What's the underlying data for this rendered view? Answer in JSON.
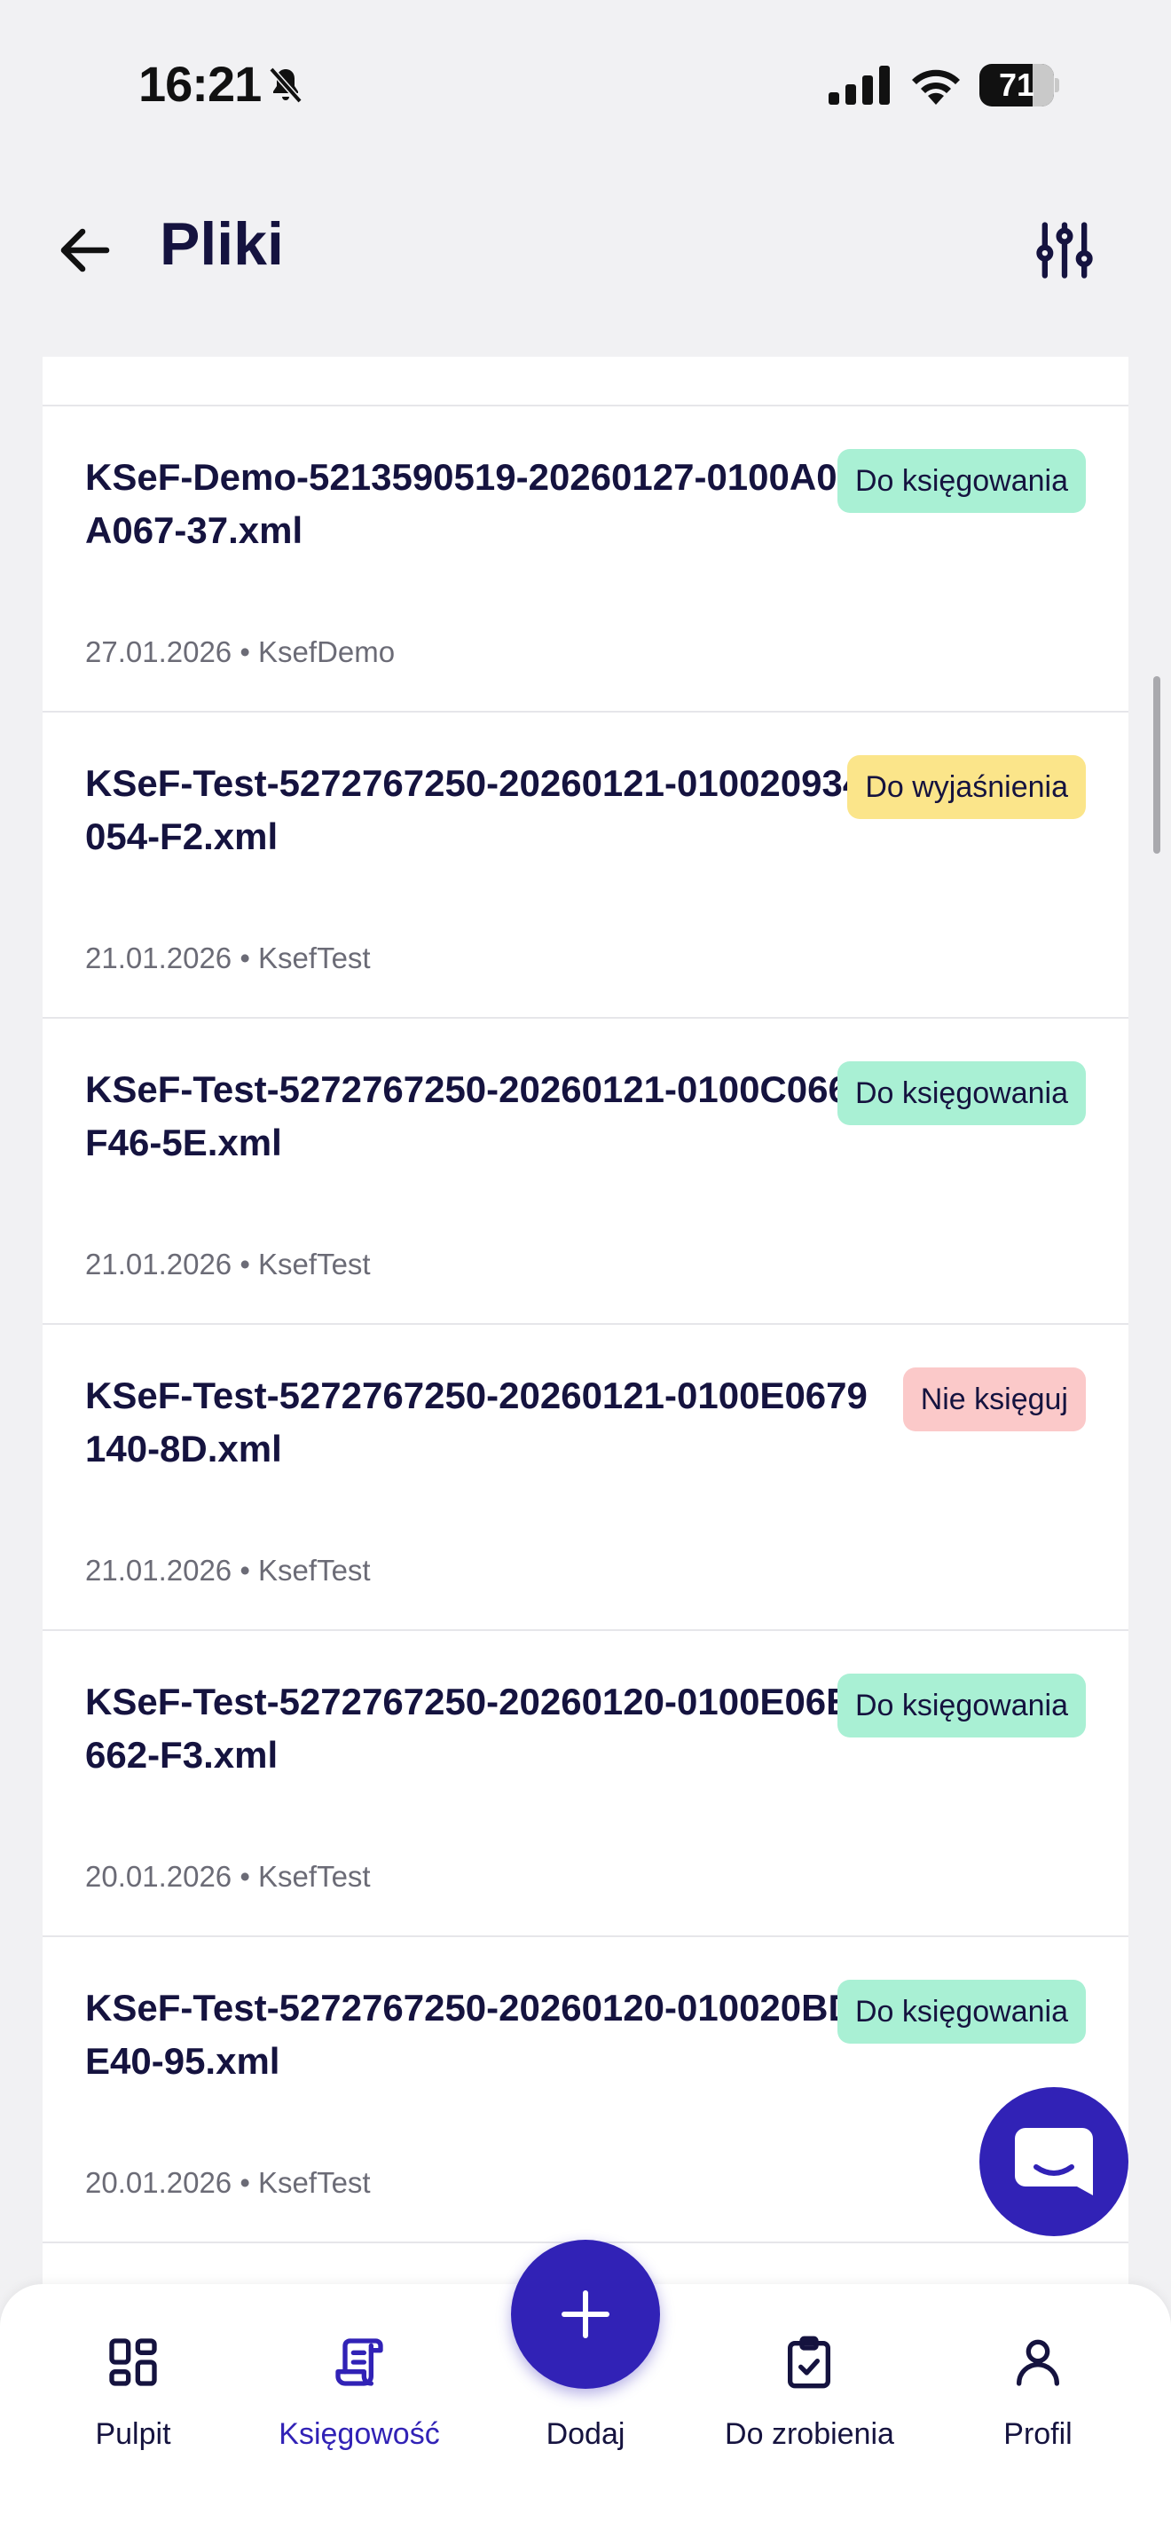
{
  "status_bar": {
    "time": "16:21",
    "battery_level": "71",
    "battery_fraction": 0.71
  },
  "header": {
    "title": "Pliki"
  },
  "files": [
    {
      "name": "KSeF-Demo-5213590519-20260127-0100A054A067-37.xml",
      "meta": "27.01.2026 • KsefDemo",
      "status": "Do księgowania",
      "status_color": "#a9f0d4"
    },
    {
      "name": "KSeF-Test-5272767250-20260121-010020934054-F2.xml",
      "meta": "21.01.2026 • KsefTest",
      "status": "Do wyjaśnienia",
      "status_color": "#fbe58a"
    },
    {
      "name": "KSeF-Test-5272767250-20260121-0100C066BF46-5E.xml",
      "meta": "21.01.2026 • KsefTest",
      "status": "Do księgowania",
      "status_color": "#a9f0d4"
    },
    {
      "name": "KSeF-Test-5272767250-20260121-0100E0679140-8D.xml",
      "meta": "21.01.2026 • KsefTest",
      "status": "Nie księguj",
      "status_color": "#fbc9c9"
    },
    {
      "name": "KSeF-Test-5272767250-20260120-0100E06BE662-F3.xml",
      "meta": "20.01.2026 • KsefTest",
      "status": "Do księgowania",
      "status_color": "#a9f0d4"
    },
    {
      "name": "KSeF-Test-5272767250-20260120-010020BDAE40-95.xml",
      "meta": "20.01.2026 • KsefTest",
      "status": "Do księgowania",
      "status_color": "#a9f0d4"
    }
  ],
  "bottom_nav": {
    "items": [
      {
        "label": "Pulpit",
        "icon": "dashboard-icon",
        "active": false
      },
      {
        "label": "Księgowość",
        "icon": "document-icon",
        "active": true
      },
      {
        "label": "Dodaj",
        "icon": "plus-icon",
        "active": false
      },
      {
        "label": "Do zrobienia",
        "icon": "clipboard-check-icon",
        "active": false
      },
      {
        "label": "Profil",
        "icon": "user-icon",
        "active": false
      }
    ]
  },
  "colors": {
    "accent": "#3122b6",
    "title": "#15133f",
    "background": "#f1f1f3"
  }
}
